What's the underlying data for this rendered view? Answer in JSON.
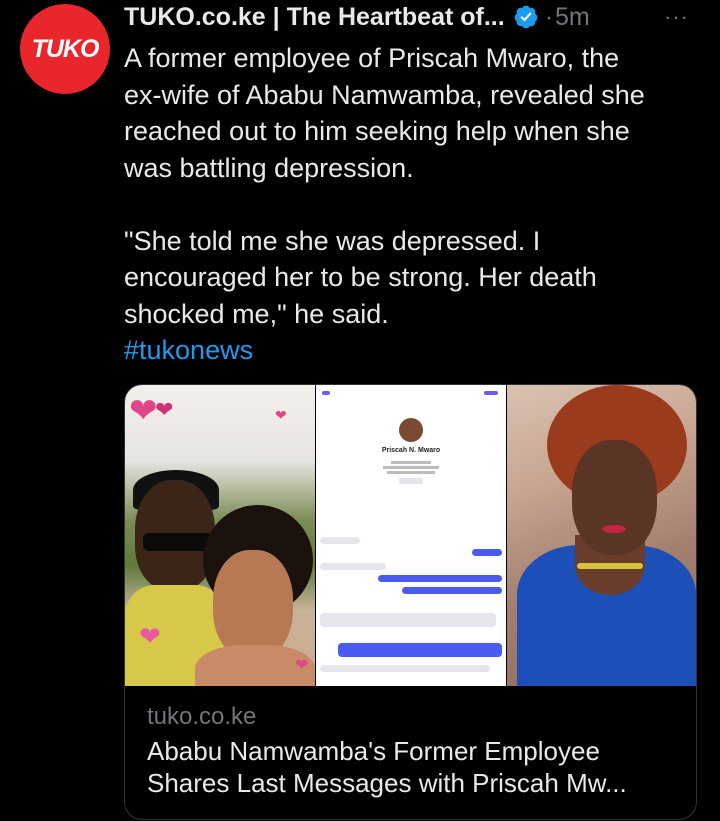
{
  "account": {
    "avatar_text": "TUKO",
    "name": "TUKO.co.ke | The Heartbeat of...",
    "separator": "·",
    "time": "5m",
    "more": "···"
  },
  "tweet": {
    "body": "A former employee of Priscah Mwaro, the\nex-wife of Ababu Namwamba, revealed she\nreached out to him seeking help when she\nwas battling depression.\n\n\"She told me she was depressed. I\nencouraged her to be strong. Her death\nshocked me,\" he said.",
    "hashtag": "#tukonews"
  },
  "card": {
    "domain": "tuko.co.ke",
    "title": "Ababu Namwamba's Former Employee\nShares Last Messages with Priscah Mw...",
    "chat_profile_name": "Priscah N. Mwaro"
  },
  "colors": {
    "background": "#000000",
    "text": "#e7e9ea",
    "muted": "#71767b",
    "link": "#1d9bf0",
    "brand": "#e8262c"
  }
}
